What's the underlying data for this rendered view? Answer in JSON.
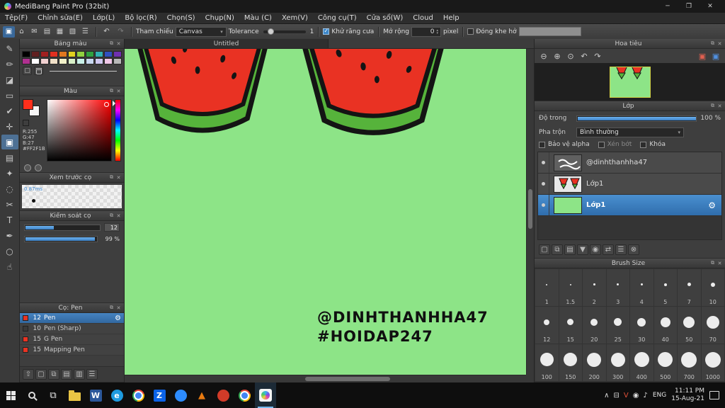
{
  "colors": {
    "accent_blue": "#3c86c8",
    "canvas_green": "#8de487",
    "melon_red": "#e93223",
    "melon_rind": "#56b33b",
    "foreground_color": "#FF2F1B"
  },
  "icons": {
    "minimize": "─",
    "maximize": "❐",
    "close": "✕",
    "popout": "⧉",
    "panel_close": "✕",
    "gear": "⚙",
    "undo": "↶",
    "redo": "↷",
    "dropdown": "▾",
    "spin_up": "▴",
    "spin_down": "▾",
    "add": "▢"
  },
  "titlebar": {
    "title": "MediBang Paint Pro (32bit)"
  },
  "menubar": {
    "items": [
      "Tệp(F)",
      "Chỉnh sửa(E)",
      "Lớp(L)",
      "Bộ lọc(R)",
      "Chọn(S)",
      "Chụp(N)",
      "Màu (C)",
      "Xem(V)",
      "Công cụ(T)",
      "Cửa sổ(W)",
      "Cloud",
      "Help"
    ]
  },
  "toolbar": {
    "icons": [
      {
        "name": "select-launcher-icon",
        "glyph": "▣",
        "selected": true
      },
      {
        "name": "home-icon",
        "glyph": "⌂"
      },
      {
        "name": "message-icon",
        "glyph": "✉"
      },
      {
        "name": "pages-icon",
        "glyph": "▤"
      },
      {
        "name": "grid-icon",
        "glyph": "▦"
      },
      {
        "name": "material-icon",
        "glyph": "▧"
      },
      {
        "name": "config-icon",
        "glyph": "☰"
      }
    ],
    "reference_label": "Tham chiếu",
    "reference_value": "Canvas",
    "tolerance_label": "Tolerance",
    "tolerance_value": "1",
    "antialias_label": "Khử răng cưa",
    "expand_label": "Mở rộng",
    "expand_value": "0",
    "pixel_label": "pixel",
    "close_gap_label": "Đóng khe hở"
  },
  "tools": [
    {
      "name": "pen-tool",
      "glyph": "✎"
    },
    {
      "name": "pencil-tool",
      "glyph": "✏"
    },
    {
      "name": "eraser-tool",
      "glyph": "◪"
    },
    {
      "name": "marquee-select-tool",
      "glyph": "▭"
    },
    {
      "name": "select-pen-tool",
      "glyph": "✔"
    },
    {
      "name": "move-tool",
      "glyph": "✛"
    },
    {
      "name": "fill-bucket-tool",
      "glyph": "▣",
      "selected": true
    },
    {
      "name": "gradient-tool",
      "glyph": "▤"
    },
    {
      "name": "magic-wand-tool",
      "glyph": "✦"
    },
    {
      "name": "lasso-tool",
      "glyph": "◌"
    },
    {
      "name": "scissors-tool",
      "glyph": "✂"
    },
    {
      "name": "text-tool",
      "glyph": "T"
    },
    {
      "name": "eyedropper-tool",
      "glyph": "✒"
    },
    {
      "name": "zoom-tool",
      "glyph": "○"
    },
    {
      "name": "hand-tool",
      "glyph": "☝"
    }
  ],
  "left_toolbar": [
    {
      "name": "up-icon",
      "glyph": "⇧"
    },
    {
      "name": "add-brush-icon",
      "glyph": "▢"
    },
    {
      "name": "duplicate-brush-icon",
      "glyph": "⧉"
    },
    {
      "name": "brush-folder-icon",
      "glyph": "▤"
    },
    {
      "name": "save-brush-icon",
      "glyph": "▥"
    },
    {
      "name": "brush-menu-icon",
      "glyph": "☰"
    }
  ],
  "panels": {
    "palette": {
      "title": "Bảng màu",
      "swatches": [
        "#000000",
        "#602020",
        "#a02020",
        "#e03020",
        "#e07820",
        "#e0d020",
        "#90d040",
        "#30a040",
        "#30b0b0",
        "#3050c0",
        "#7030b0",
        "#b03090",
        "#ffffff",
        "#f0d0d0",
        "#f0e0c8",
        "#f0f0c8",
        "#d8f0c8",
        "#c8f0e8",
        "#c8d8f0",
        "#d0c8f0",
        "#f0c8e8",
        "#b8b8b8"
      ]
    },
    "color": {
      "title": "Màu",
      "values": [
        "R:255",
        "G:47",
        "B:27",
        "#FF2F1B"
      ]
    },
    "preview": {
      "title": "Xem trước cọ",
      "speed": "0.87ms"
    },
    "control": {
      "title": "Kiểm soát cọ",
      "size_value": "12",
      "opacity_value": "99 %"
    },
    "brushes": {
      "title": "Cọ: Pen",
      "items": [
        {
          "size": "12",
          "name": "Pen",
          "color": "#e83323",
          "selected": true
        },
        {
          "size": "10",
          "name": "Pen (Sharp)",
          "color": "#3a3a3a"
        },
        {
          "size": "15",
          "name": "G Pen",
          "color": "#e83323"
        },
        {
          "size": "15",
          "name": "Mapping Pen",
          "color": "#e83323"
        }
      ]
    },
    "navigator": {
      "title": "Hoa tiêu",
      "icons": [
        {
          "name": "zoom-out-icon",
          "glyph": "⊖"
        },
        {
          "name": "zoom-in-icon",
          "glyph": "⊕"
        },
        {
          "name": "zoom-reset-icon",
          "glyph": "⊙"
        },
        {
          "name": "rotate-left-icon",
          "glyph": "↶"
        },
        {
          "name": "rotate-right-icon",
          "glyph": "↷"
        },
        {
          "name": "flip-view-icon",
          "glyph": "▣",
          "color": "#e06050"
        },
        {
          "name": "fit-view-icon",
          "glyph": "▣",
          "color": "#5090e0"
        }
      ]
    },
    "layer": {
      "title": "Lớp",
      "opacity_label": "Độ trong",
      "opacity_value": "100 %",
      "blend_label": "Pha trộn",
      "blend_value": "Bình thường",
      "protect_alpha_label": "Bảo vệ alpha",
      "clip_label": "Xén bớt",
      "lock_label": "Khóa",
      "layers": [
        {
          "name": "@dinhthanhha47"
        },
        {
          "name": "Lớp1"
        },
        {
          "name": "Lớp1",
          "selected": true
        }
      ],
      "tools": [
        {
          "name": "add-layer-icon",
          "glyph": "▢"
        },
        {
          "name": "duplicate-layer-icon",
          "glyph": "⧉"
        },
        {
          "name": "layer-folder-icon",
          "glyph": "▤"
        },
        {
          "name": "merge-down-icon",
          "glyph": "▼"
        },
        {
          "name": "layer-camera-icon",
          "glyph": "◉"
        },
        {
          "name": "transfer-layer-icon",
          "glyph": "⇄"
        },
        {
          "name": "layer-menu-icon",
          "glyph": "☰"
        },
        {
          "name": "delete-layer-icon",
          "glyph": "⊗"
        }
      ]
    },
    "brush_size": {
      "title": "Brush Size",
      "sizes": [
        "1",
        "1.5",
        "2",
        "3",
        "4",
        "5",
        "7",
        "10",
        "12",
        "15",
        "20",
        "25",
        "30",
        "40",
        "50",
        "70",
        "100",
        "150",
        "200",
        "300",
        "400",
        "500",
        "700",
        "1000"
      ]
    }
  },
  "canvas": {
    "tab": "Untitled",
    "handle_line1": "@DINHTHANHHA47",
    "handle_line2": "#HOIDAP247"
  },
  "taskbar": {
    "apps": [
      {
        "name": "start-button",
        "kind": "start"
      },
      {
        "name": "search-button",
        "kind": "search"
      },
      {
        "name": "task-view-button",
        "kind": "glyph",
        "glyph": "⧉",
        "color": "#e8e8e8"
      },
      {
        "name": "file-explorer",
        "kind": "folder"
      },
      {
        "name": "word",
        "kind": "square",
        "letter": "W",
        "color": "#2b579a"
      },
      {
        "name": "edge",
        "kind": "circle",
        "letter": "e",
        "color": "#1e9be0"
      },
      {
        "name": "chrome",
        "kind": "chrome"
      },
      {
        "name": "zalo",
        "kind": "square",
        "letter": "Z",
        "color": "#0c63e8"
      },
      {
        "name": "zoom",
        "kind": "circle",
        "letter": "",
        "color": "#2d8cff"
      },
      {
        "name": "vlc",
        "kind": "glyph",
        "glyph": "▲",
        "color": "#e87a10"
      },
      {
        "name": "photos",
        "kind": "circle",
        "letter": "",
        "color": "#d23b28"
      },
      {
        "name": "chrome-profile",
        "kind": "chrome"
      },
      {
        "name": "medibang-paint",
        "kind": "medibang",
        "active": true
      }
    ],
    "tray": [
      {
        "name": "hidden-icons-chevron",
        "glyph": "∧"
      },
      {
        "name": "onedrive-icon",
        "glyph": "⊟"
      },
      {
        "name": "vlc-tray-icon",
        "glyph": "V",
        "color": "#e05038"
      },
      {
        "name": "network-icon",
        "glyph": "◉"
      },
      {
        "name": "volume-icon",
        "glyph": "♪"
      }
    ],
    "tray_language": "ENG",
    "tray_time": "11:11 PM",
    "tray_date": "15-Aug-21"
  }
}
